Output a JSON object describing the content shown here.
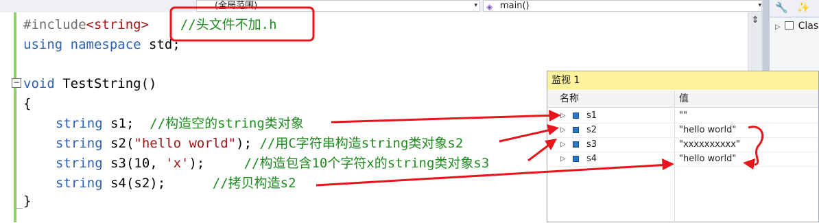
{
  "toolbar": {
    "scope_combo": "(全局范围)",
    "member_combo": "main()",
    "dropdown_glyph": "▾"
  },
  "code": {
    "include_directive": "#include",
    "include_header": "<string>",
    "include_comment": "//头文件不加.h",
    "line2_kw": "using namespace",
    "line2_rest": " std;",
    "func_kw": "void",
    "func_name": " TestString()",
    "open_brace": "{",
    "close_brace": "}",
    "statements": [
      {
        "type": "string",
        "rest": " s1;  ",
        "arg": "",
        "tail": "",
        "comment": "//构造空的string类对象"
      },
      {
        "type": "string",
        "rest": " s2(",
        "arg": "\"hello world\"",
        "tail": "); ",
        "comment": "//用C字符串构造string类对象s2"
      },
      {
        "type": "string",
        "rest": " s3(10, ",
        "arg": "'x'",
        "tail": ");     ",
        "comment": "//构造包含10个字符x的string类对象s3"
      },
      {
        "type": "string",
        "rest": " s4(s2);      ",
        "arg": "",
        "tail": "",
        "comment": "//拷贝构造s2"
      }
    ]
  },
  "watch": {
    "title": "监视 1",
    "col_name": "名称",
    "col_value": "值",
    "rows": [
      {
        "name": "s1",
        "value": "\"\""
      },
      {
        "name": "s2",
        "value": "\"hello world\""
      },
      {
        "name": "s3",
        "value": "\"xxxxxxxxxx\""
      },
      {
        "name": "s4",
        "value": "\"hello world\""
      }
    ]
  },
  "right_panel": {
    "class_label": "Clas"
  },
  "colors": {
    "annotation_red": "#e8141b",
    "keyword_blue": "#2b5fb3",
    "string_red": "#a31515",
    "comment_green": "#1e8c1e",
    "watch_title_yellow": "#fff29d"
  }
}
